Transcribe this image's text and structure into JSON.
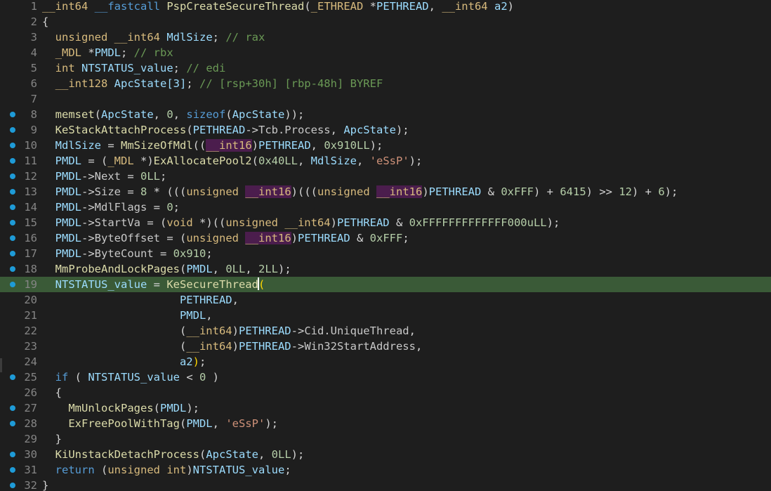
{
  "editor": {
    "cursor_line": 19,
    "colors": {
      "background": "#1e1e1e",
      "current_line": "#3a5a37",
      "breakpoint": "#1e9bd7",
      "line_number": "#858585",
      "type_highlight_bg": "#4b1d4d"
    },
    "breakpoint_icon": "breakpoint-dot-icon",
    "lines": [
      {
        "n": "1",
        "bp": false,
        "segs": [
          [
            "ty",
            "__int64"
          ],
          [
            "pl",
            " "
          ],
          [
            "kw",
            "__fastcall"
          ],
          [
            "pl",
            " "
          ],
          [
            "fn",
            "PspCreateSecureThread"
          ],
          [
            "pl",
            "("
          ],
          [
            "ty",
            "_ETHREAD"
          ],
          [
            "pl",
            " *"
          ],
          [
            "var",
            "PETHREAD"
          ],
          [
            "pl",
            ", "
          ],
          [
            "ty",
            "__int64"
          ],
          [
            "pl",
            " "
          ],
          [
            "var",
            "a2"
          ],
          [
            "pl",
            ")"
          ]
        ]
      },
      {
        "n": "2",
        "bp": false,
        "segs": [
          [
            "pl",
            "{"
          ]
        ]
      },
      {
        "n": "3",
        "bp": false,
        "segs": [
          [
            "pl",
            "  "
          ],
          [
            "ty",
            "unsigned __int64"
          ],
          [
            "pl",
            " "
          ],
          [
            "var",
            "MdlSize"
          ],
          [
            "pl",
            "; "
          ],
          [
            "cm",
            "// rax"
          ]
        ]
      },
      {
        "n": "4",
        "bp": false,
        "segs": [
          [
            "pl",
            "  "
          ],
          [
            "ty",
            "_MDL"
          ],
          [
            "pl",
            " *"
          ],
          [
            "var",
            "PMDL"
          ],
          [
            "pl",
            "; "
          ],
          [
            "cm",
            "// rbx"
          ]
        ]
      },
      {
        "n": "5",
        "bp": false,
        "segs": [
          [
            "pl",
            "  "
          ],
          [
            "ty",
            "int"
          ],
          [
            "pl",
            " "
          ],
          [
            "var",
            "NTSTATUS_value"
          ],
          [
            "pl",
            "; "
          ],
          [
            "cm",
            "// edi"
          ]
        ]
      },
      {
        "n": "6",
        "bp": false,
        "segs": [
          [
            "pl",
            "  "
          ],
          [
            "ty",
            "__int128"
          ],
          [
            "pl",
            " "
          ],
          [
            "var",
            "ApcState[3]"
          ],
          [
            "pl",
            "; "
          ],
          [
            "cm",
            "// [rsp+30h] [rbp-48h] BYREF"
          ]
        ]
      },
      {
        "n": "7",
        "bp": false,
        "segs": []
      },
      {
        "n": "8",
        "bp": true,
        "segs": [
          [
            "pl",
            "  "
          ],
          [
            "fn",
            "memset"
          ],
          [
            "pl",
            "("
          ],
          [
            "var",
            "ApcState"
          ],
          [
            "pl",
            ", "
          ],
          [
            "num",
            "0"
          ],
          [
            "pl",
            ", "
          ],
          [
            "kw",
            "sizeof"
          ],
          [
            "pl",
            "("
          ],
          [
            "var",
            "ApcState"
          ],
          [
            "pl",
            "));"
          ]
        ]
      },
      {
        "n": "9",
        "bp": true,
        "segs": [
          [
            "pl",
            "  "
          ],
          [
            "fn",
            "KeStackAttachProcess"
          ],
          [
            "pl",
            "("
          ],
          [
            "var",
            "PETHREAD"
          ],
          [
            "pl",
            "->"
          ],
          [
            "fld",
            "Tcb.Process"
          ],
          [
            "pl",
            ", "
          ],
          [
            "var",
            "ApcState"
          ],
          [
            "pl",
            ");"
          ]
        ]
      },
      {
        "n": "10",
        "bp": true,
        "segs": [
          [
            "pl",
            "  "
          ],
          [
            "var",
            "MdlSize"
          ],
          [
            "pl",
            " = "
          ],
          [
            "fn",
            "MmSizeOfMdl"
          ],
          [
            "pl",
            "(("
          ],
          [
            "tyv",
            "__int16"
          ],
          [
            "pl",
            ")"
          ],
          [
            "var",
            "PETHREAD"
          ],
          [
            "pl",
            ", "
          ],
          [
            "num",
            "0x910LL"
          ],
          [
            "pl",
            ");"
          ]
        ]
      },
      {
        "n": "11",
        "bp": true,
        "segs": [
          [
            "pl",
            "  "
          ],
          [
            "var",
            "PMDL"
          ],
          [
            "pl",
            " = ("
          ],
          [
            "ty",
            "_MDL"
          ],
          [
            "pl",
            " *)"
          ],
          [
            "fn",
            "ExAllocatePool2"
          ],
          [
            "pl",
            "("
          ],
          [
            "num",
            "0x40LL"
          ],
          [
            "pl",
            ", "
          ],
          [
            "var",
            "MdlSize"
          ],
          [
            "pl",
            ", "
          ],
          [
            "str",
            "'eSsP'"
          ],
          [
            "pl",
            ");"
          ]
        ]
      },
      {
        "n": "12",
        "bp": true,
        "segs": [
          [
            "pl",
            "  "
          ],
          [
            "var",
            "PMDL"
          ],
          [
            "pl",
            "->"
          ],
          [
            "fld",
            "Next"
          ],
          [
            "pl",
            " = "
          ],
          [
            "num",
            "0LL"
          ],
          [
            "pl",
            ";"
          ]
        ]
      },
      {
        "n": "13",
        "bp": true,
        "segs": [
          [
            "pl",
            "  "
          ],
          [
            "var",
            "PMDL"
          ],
          [
            "pl",
            "->"
          ],
          [
            "fld",
            "Size"
          ],
          [
            "pl",
            " = "
          ],
          [
            "num",
            "8"
          ],
          [
            "pl",
            " * ((("
          ],
          [
            "ty",
            "unsigned "
          ],
          [
            "tyv",
            "__int16"
          ],
          [
            "pl",
            ")((("
          ],
          [
            "ty",
            "unsigned "
          ],
          [
            "tyv",
            "__int16"
          ],
          [
            "pl",
            ")"
          ],
          [
            "var",
            "PETHREAD"
          ],
          [
            "pl",
            " & "
          ],
          [
            "num",
            "0xFFF"
          ],
          [
            "pl",
            ") + "
          ],
          [
            "num",
            "6415"
          ],
          [
            "pl",
            ") >> "
          ],
          [
            "num",
            "12"
          ],
          [
            "pl",
            ") + "
          ],
          [
            "num",
            "6"
          ],
          [
            "pl",
            ");"
          ]
        ]
      },
      {
        "n": "14",
        "bp": true,
        "segs": [
          [
            "pl",
            "  "
          ],
          [
            "var",
            "PMDL"
          ],
          [
            "pl",
            "->"
          ],
          [
            "fld",
            "MdlFlags"
          ],
          [
            "pl",
            " = "
          ],
          [
            "num",
            "0"
          ],
          [
            "pl",
            ";"
          ]
        ]
      },
      {
        "n": "15",
        "bp": true,
        "segs": [
          [
            "pl",
            "  "
          ],
          [
            "var",
            "PMDL"
          ],
          [
            "pl",
            "->"
          ],
          [
            "fld",
            "StartVa"
          ],
          [
            "pl",
            " = ("
          ],
          [
            "ty",
            "void"
          ],
          [
            "pl",
            " *)(("
          ],
          [
            "ty",
            "unsigned __int64"
          ],
          [
            "pl",
            ")"
          ],
          [
            "var",
            "PETHREAD"
          ],
          [
            "pl",
            " & "
          ],
          [
            "num",
            "0xFFFFFFFFFFFFF000uLL"
          ],
          [
            "pl",
            ");"
          ]
        ]
      },
      {
        "n": "16",
        "bp": true,
        "segs": [
          [
            "pl",
            "  "
          ],
          [
            "var",
            "PMDL"
          ],
          [
            "pl",
            "->"
          ],
          [
            "fld",
            "ByteOffset"
          ],
          [
            "pl",
            " = ("
          ],
          [
            "ty",
            "unsigned "
          ],
          [
            "tyv",
            "__int16"
          ],
          [
            "pl",
            ")"
          ],
          [
            "var",
            "PETHREAD"
          ],
          [
            "pl",
            " & "
          ],
          [
            "num",
            "0xFFF"
          ],
          [
            "pl",
            ";"
          ]
        ]
      },
      {
        "n": "17",
        "bp": true,
        "segs": [
          [
            "pl",
            "  "
          ],
          [
            "var",
            "PMDL"
          ],
          [
            "pl",
            "->"
          ],
          [
            "fld",
            "ByteCount"
          ],
          [
            "pl",
            " = "
          ],
          [
            "num",
            "0x910"
          ],
          [
            "pl",
            ";"
          ]
        ]
      },
      {
        "n": "18",
        "bp": true,
        "segs": [
          [
            "pl",
            "  "
          ],
          [
            "fn",
            "MmProbeAndLockPages"
          ],
          [
            "pl",
            "("
          ],
          [
            "var",
            "PMDL"
          ],
          [
            "pl",
            ", "
          ],
          [
            "num",
            "0LL"
          ],
          [
            "pl",
            ", "
          ],
          [
            "num",
            "2LL"
          ],
          [
            "pl",
            ");"
          ]
        ]
      },
      {
        "n": "19",
        "bp": true,
        "segs": [
          [
            "pl",
            "  "
          ],
          [
            "var",
            "NTSTATUS_value"
          ],
          [
            "pl",
            " = "
          ],
          [
            "fn",
            "KeSecureThread"
          ],
          [
            "cursor",
            ""
          ],
          [
            "phl",
            "("
          ]
        ]
      },
      {
        "n": "20",
        "bp": false,
        "segs": [
          [
            "pl",
            "                     "
          ],
          [
            "var",
            "PETHREAD"
          ],
          [
            "pl",
            ","
          ]
        ]
      },
      {
        "n": "21",
        "bp": false,
        "segs": [
          [
            "pl",
            "                     "
          ],
          [
            "var",
            "PMDL"
          ],
          [
            "pl",
            ","
          ]
        ]
      },
      {
        "n": "22",
        "bp": false,
        "segs": [
          [
            "pl",
            "                     ("
          ],
          [
            "ty",
            "__int64"
          ],
          [
            "pl",
            ")"
          ],
          [
            "var",
            "PETHREAD"
          ],
          [
            "pl",
            "->"
          ],
          [
            "fld",
            "Cid.UniqueThread"
          ],
          [
            "pl",
            ","
          ]
        ]
      },
      {
        "n": "23",
        "bp": false,
        "segs": [
          [
            "pl",
            "                     ("
          ],
          [
            "ty",
            "__int64"
          ],
          [
            "pl",
            ")"
          ],
          [
            "var",
            "PETHREAD"
          ],
          [
            "pl",
            "->"
          ],
          [
            "fld",
            "Win32StartAddress"
          ],
          [
            "pl",
            ","
          ]
        ]
      },
      {
        "n": "24",
        "bp": false,
        "segs": [
          [
            "pl",
            "                     "
          ],
          [
            "var",
            "a2"
          ],
          [
            "phl",
            ")"
          ],
          [
            "pl",
            ";"
          ]
        ]
      },
      {
        "n": "25",
        "bp": true,
        "segs": [
          [
            "pl",
            "  "
          ],
          [
            "kw",
            "if"
          ],
          [
            "pl",
            " ( "
          ],
          [
            "var",
            "NTSTATUS_value"
          ],
          [
            "pl",
            " < "
          ],
          [
            "num",
            "0"
          ],
          [
            "pl",
            " )"
          ]
        ]
      },
      {
        "n": "26",
        "bp": false,
        "segs": [
          [
            "pl",
            "  {"
          ]
        ]
      },
      {
        "n": "27",
        "bp": true,
        "segs": [
          [
            "pl",
            "    "
          ],
          [
            "fn",
            "MmUnlockPages"
          ],
          [
            "pl",
            "("
          ],
          [
            "var",
            "PMDL"
          ],
          [
            "pl",
            ");"
          ]
        ]
      },
      {
        "n": "28",
        "bp": true,
        "segs": [
          [
            "pl",
            "    "
          ],
          [
            "fn",
            "ExFreePoolWithTag"
          ],
          [
            "pl",
            "("
          ],
          [
            "var",
            "PMDL"
          ],
          [
            "pl",
            ", "
          ],
          [
            "str",
            "'eSsP'"
          ],
          [
            "pl",
            ");"
          ]
        ]
      },
      {
        "n": "29",
        "bp": false,
        "segs": [
          [
            "pl",
            "  }"
          ]
        ]
      },
      {
        "n": "30",
        "bp": true,
        "segs": [
          [
            "pl",
            "  "
          ],
          [
            "fn",
            "KiUnstackDetachProcess"
          ],
          [
            "pl",
            "("
          ],
          [
            "var",
            "ApcState"
          ],
          [
            "pl",
            ", "
          ],
          [
            "num",
            "0LL"
          ],
          [
            "pl",
            ");"
          ]
        ]
      },
      {
        "n": "31",
        "bp": true,
        "segs": [
          [
            "pl",
            "  "
          ],
          [
            "kw",
            "return"
          ],
          [
            "pl",
            " ("
          ],
          [
            "ty",
            "unsigned int"
          ],
          [
            "pl",
            ")"
          ],
          [
            "var",
            "NTSTATUS_value"
          ],
          [
            "pl",
            ";"
          ]
        ]
      },
      {
        "n": "32",
        "bp": true,
        "segs": [
          [
            "pl",
            "}"
          ]
        ]
      }
    ]
  }
}
